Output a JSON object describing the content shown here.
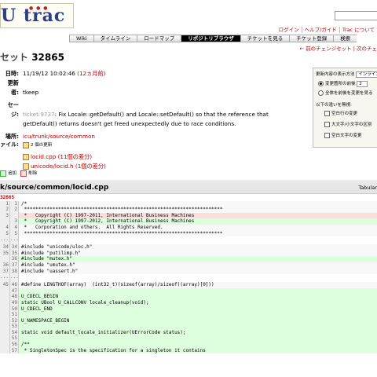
{
  "logo": {
    "text": "U trac"
  },
  "metanav": [
    "ログイン",
    "ヘルプ/ガイド",
    "Trac について"
  ],
  "mainnav": [
    {
      "label": "Wiki",
      "active": false
    },
    {
      "label": "タイムライン",
      "active": false
    },
    {
      "label": "ロードマップ",
      "active": false
    },
    {
      "label": "リポジトリブラウザ",
      "active": true
    },
    {
      "label": "チケットを見る",
      "active": false
    },
    {
      "label": "チケット登録",
      "active": false
    },
    {
      "label": "検索",
      "active": false
    }
  ],
  "ctxnav": [
    "← 前のチェンジセット",
    "次のチェ"
  ],
  "title": {
    "prefix": "セット",
    "number": "32865"
  },
  "props": {
    "date_label": "日時:",
    "date": "11/19/12 10:02:46",
    "date_rel": "(12ヵ月前)",
    "author_label": "更新者:",
    "author": "tkeep",
    "msg_label": "セージ:",
    "msg_ticket": "ticket:9737",
    "msg_line1": ": Fix Locale::getDefault() and Locale::setDefault() so that the reference that",
    "msg_line2": "getDefault() returns doesn't get freed unexpectedly due to race conditions.",
    "loc_label": "場所:",
    "location": "icu/trunk/source/common",
    "files_label": "ァイル:",
    "files_summary": "2 個の更新",
    "files": [
      {
        "name": "locid.cpp",
        "diff": "(11個の差分)"
      },
      {
        "name": "unicode/locid.h",
        "diff": "(1個の差分)"
      }
    ]
  },
  "options": {
    "title": "更新内容の表示方法",
    "style": "インライン",
    "radio1": "変更箇所の前後",
    "context_lines": "2",
    "radio2": "全体を前後を変更を見る",
    "ignore_title": "以下の違いを無視:",
    "chk1": "空白行の変更",
    "chk2": "大文字/小文字の区別",
    "chk3": "空白文字の変更"
  },
  "legend": {
    "added": "追加",
    "removed": "削除"
  },
  "file_header": {
    "path": "k/source/common/locid.cpp",
    "view": "Tabular"
  },
  "diff_rev": "32865",
  "diff_lines": [
    {
      "l": "1",
      "r": "1",
      "type": "ctx",
      "text": "/*"
    },
    {
      "l": "2",
      "r": "2",
      "type": "ctx",
      "text": " **********************************************************************"
    },
    {
      "l": "3",
      "r": "",
      "type": "rem",
      "text": " *   Copyright (C) 1997-2011, International Business Machines"
    },
    {
      "l": "",
      "r": "3",
      "type": "add",
      "text": " *   Copyright (C) 1997-2012, International Business Machines"
    },
    {
      "l": "4",
      "r": "4",
      "type": "ctx",
      "text": " *   Corporation and others.  All Rights Reserved."
    },
    {
      "l": "5",
      "r": "5",
      "type": "ctx",
      "text": " **********************************************************************"
    },
    {
      "l": "...",
      "r": "...",
      "type": "blank",
      "text": ""
    },
    {
      "l": "34",
      "r": "34",
      "type": "ctx",
      "text": "#include \"unicode/uloc.h\""
    },
    {
      "l": "35",
      "r": "35",
      "type": "ctx",
      "text": "#include \"putilimp.h\""
    },
    {
      "l": "",
      "r": "36",
      "type": "add",
      "text": "#include \"mutex.h\""
    },
    {
      "l": "36",
      "r": "37",
      "type": "ctx",
      "text": "#include \"umutex.h\""
    },
    {
      "l": "37",
      "r": "38",
      "type": "ctx",
      "text": "#include \"uassert.h\""
    },
    {
      "l": "...",
      "r": "...",
      "type": "blank",
      "text": ""
    },
    {
      "l": "45",
      "r": "46",
      "type": "ctx",
      "text": "#define LENGTHOF(array)  (int32_t)(sizeof(array)/sizeof((array)[0]))"
    },
    {
      "l": "",
      "r": "47",
      "type": "add",
      "text": ""
    },
    {
      "l": "",
      "r": "48",
      "type": "add",
      "text": "U_CDECL_BEGIN"
    },
    {
      "l": "",
      "r": "49",
      "type": "add",
      "text": "static UBool U_CALLCONV locale_cleanup(void);"
    },
    {
      "l": "",
      "r": "50",
      "type": "add",
      "text": "U_CDECL_END"
    },
    {
      "l": "",
      "r": "51",
      "type": "add",
      "text": ""
    },
    {
      "l": "",
      "r": "52",
      "type": "add",
      "text": "U_NAMESPACE_BEGIN"
    },
    {
      "l": "",
      "r": "53",
      "type": "add",
      "text": ""
    },
    {
      "l": "",
      "r": "54",
      "type": "add",
      "text": "static void default_locale_initializer(UErrorCode status);"
    },
    {
      "l": "",
      "r": "55",
      "type": "add",
      "text": ""
    },
    {
      "l": "",
      "r": "56",
      "type": "add",
      "text": "/**"
    },
    {
      "l": "",
      "r": "57",
      "type": "add",
      "text": " * SingletonSpec is the specification for a singleton it contains"
    }
  ]
}
